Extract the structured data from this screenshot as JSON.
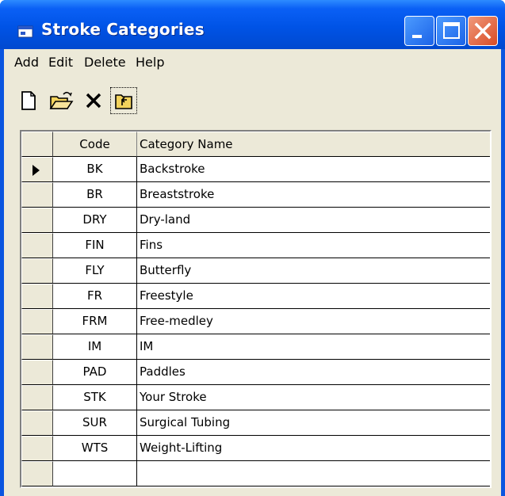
{
  "window": {
    "title": "Stroke Categories",
    "icon": "window-icon",
    "buttons": [
      "minimize-icon",
      "maximize-icon",
      "close-icon"
    ]
  },
  "menu": {
    "items": [
      {
        "label": "Add"
      },
      {
        "label": "Edit"
      },
      {
        "label": "Delete"
      },
      {
        "label": "Help"
      }
    ]
  },
  "toolbar": {
    "tools": [
      "new-document-icon",
      "open-folder-icon",
      "delete-x-icon",
      "up-folder-icon"
    ]
  },
  "grid": {
    "headers": {
      "code": "Code",
      "name": "Category Name"
    },
    "rows": [
      {
        "code": "BK",
        "name": "Backstroke",
        "current": true
      },
      {
        "code": "BR",
        "name": "Breaststroke"
      },
      {
        "code": "DRY",
        "name": "Dry-land"
      },
      {
        "code": "FIN",
        "name": "Fins"
      },
      {
        "code": "FLY",
        "name": "Butterfly"
      },
      {
        "code": "FR",
        "name": "Freestyle"
      },
      {
        "code": "FRM",
        "name": "Free-medley"
      },
      {
        "code": "IM",
        "name": "IM"
      },
      {
        "code": "PAD",
        "name": "Paddles"
      },
      {
        "code": "STK",
        "name": "Your Stroke"
      },
      {
        "code": "SUR",
        "name": "Surgical Tubing"
      },
      {
        "code": "WTS",
        "name": "Weight-Lifting"
      },
      {
        "code": "",
        "name": ""
      }
    ]
  },
  "colors": {
    "titlebar": "#0053e6",
    "client": "#ece9d8",
    "close_button": "#d94b24"
  }
}
